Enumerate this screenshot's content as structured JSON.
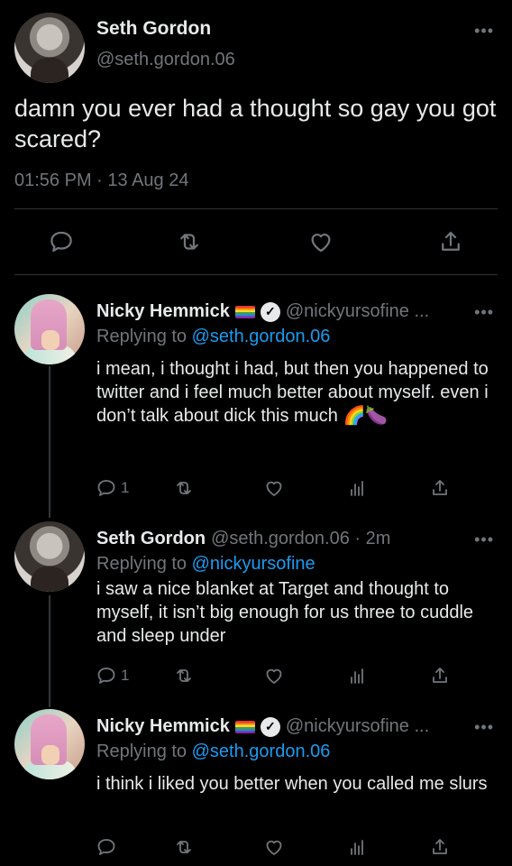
{
  "main_tweet": {
    "name": "Seth Gordon",
    "handle": "@seth.gordon.06",
    "more": "•••",
    "text": "damn you ever had a thought so gay you got scared?",
    "time": "01:56 PM · 13 Aug 24"
  },
  "replies": [
    {
      "name": "Nicky Hemmick",
      "handle": "@nickyursofine ...",
      "replying_label": "Replying to",
      "replying_to": "@seth.gordon.06",
      "text": "i mean, i thought i had, but then you happened to twitter and i feel much better about myself. even i don’t talk about dick this much",
      "emoji": "🌈🍆",
      "reply_count": "1"
    },
    {
      "name": "Seth Gordon",
      "handle": "@seth.gordon.06 · 2m",
      "replying_label": "Replying to",
      "replying_to": "@nickyursofine",
      "text": "i saw a nice blanket at Target and thought to myself, it isn’t big enough for us three to cuddle and sleep under",
      "reply_count": "1"
    },
    {
      "name": "Nicky Hemmick",
      "handle": "@nickyursofine ...",
      "replying_label": "Replying to",
      "replying_to": "@seth.gordon.06",
      "text": "i think i liked you better when you called me slurs"
    }
  ],
  "icons": {
    "reply": "reply-icon",
    "retweet": "retweet-icon",
    "like": "heart-icon",
    "views": "views-icon",
    "share": "share-icon",
    "verified": "verified-check-icon",
    "flag": "rainbow-flag-icon"
  },
  "colors": {
    "background": "#000000",
    "text": "#e7e9ea",
    "muted": "#71767b",
    "link": "#1d9bf0"
  }
}
